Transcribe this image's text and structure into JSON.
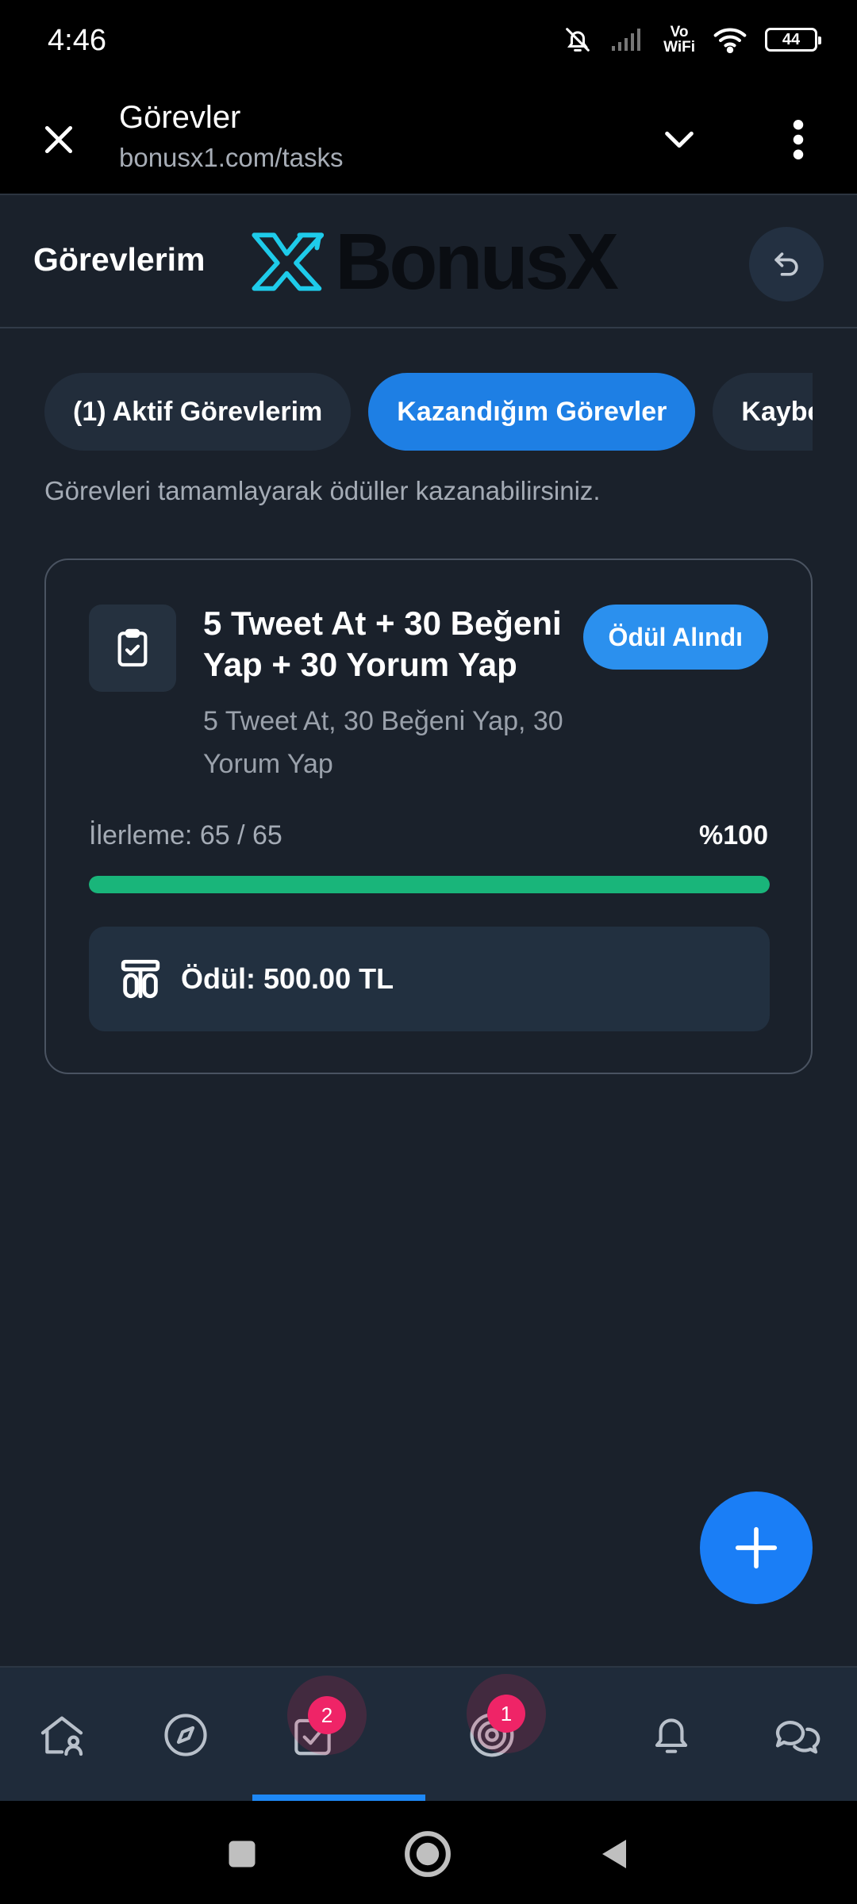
{
  "status_bar": {
    "time": "4:46",
    "network": "Vo WiFi",
    "network_line1": "Vo",
    "network_line2": "WiFi",
    "battery": "44"
  },
  "browser": {
    "title": "Görevler",
    "url": "bonusx1.com/tasks"
  },
  "header": {
    "title": "Görevlerim",
    "logo_text": "BonusX"
  },
  "tabs": [
    {
      "label": "(1) Aktif Görevlerim",
      "active": false
    },
    {
      "label": "Kazandığım Görevler",
      "active": true
    },
    {
      "label": "Kaybet",
      "active": false
    }
  ],
  "subtitle": "Görevleri tamamlayarak ödüller kazanabilirsiniz.",
  "task": {
    "title": "5 Tweet At + 30 Beğeni Yap + 30 Yorum Yap",
    "description": "5 Tweet At, 30 Beğeni Yap, 30 Yorum Yap",
    "status": "Ödül Alındı",
    "progress_label": "İlerleme: 65 / 65",
    "progress_percent_text": "%100",
    "progress_fraction": 1.0,
    "reward": "Ödül: 500.00 TL"
  },
  "bottom_nav": {
    "items": [
      {
        "name": "home-icon"
      },
      {
        "name": "compass-icon"
      },
      {
        "name": "tasks-icon",
        "badge": "2"
      },
      {
        "name": "target-icon",
        "badge": "1"
      },
      {
        "name": "bell-icon"
      },
      {
        "name": "chat-icon"
      }
    ],
    "badges": {
      "tasks": "2",
      "target": "1"
    }
  },
  "colors": {
    "accent": "#1e7fe4",
    "progress": "#19b57a",
    "badge": "#ef2467",
    "background": "#1a212b",
    "logo_cyan": "#1ecbea"
  }
}
